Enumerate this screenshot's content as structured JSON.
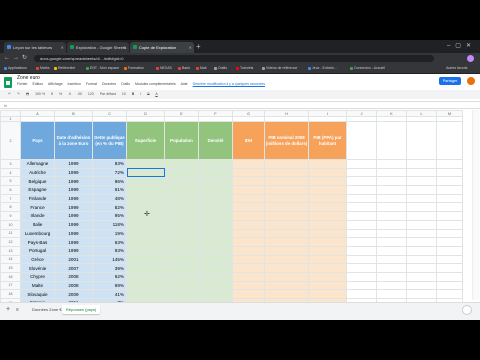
{
  "browser": {
    "tabs": [
      {
        "label": "Leçon sur les tableurs",
        "color": "#4285f4"
      },
      {
        "label": "Exploration - Google Sheets",
        "color": "#0f9d58"
      },
      {
        "label": "Copie de Exploration",
        "color": "#0f9d58"
      }
    ],
    "active_tab": 2,
    "url": "docs.google.com/spreadsheets/d/…/edit#gid=0",
    "bookmarks": [
      "Applications",
      "Maths",
      "Référentiel",
      "ENT - Mon espace",
      "Formation",
      "NEXAS",
      "Bank",
      "Mail",
      "Outils",
      "Tutoriels",
      "Vidéos de référence",
      "Jeux - Entraîn…",
      "Connexion - Accueil"
    ],
    "other_bookmarks": "Autres favoris"
  },
  "sheets": {
    "doc_title": "Zone euro",
    "menu": [
      "Fichier",
      "Édition",
      "Affichage",
      "Insertion",
      "Format",
      "Données",
      "Outils",
      "Modules complémentaires",
      "Aide"
    ],
    "last_edit": "Dernière modification il y a quelques secondes",
    "share_label": "Partager",
    "toolbar": [
      "↶",
      "↷",
      "🖶",
      "100 %",
      "€",
      "%",
      ".0",
      ".00",
      "123",
      "Par défaut",
      "10",
      "B",
      "I",
      "S",
      "A"
    ],
    "fx": "fx",
    "column_letters": [
      "A",
      "B",
      "C",
      "D",
      "E",
      "F",
      "G",
      "H",
      "I",
      "J",
      "K",
      "L",
      "M"
    ],
    "headers": {
      "pays": "Pays",
      "date": "Date d'adhésion à la zone Euro",
      "dette": "Dette publique (en % du PIB)",
      "superficie": "Superficie",
      "population": "Population",
      "densite": "Densité",
      "idh": "IDH",
      "pib": "PIB nominal 2008 (millions de dollars)",
      "pib_hab": "PIB (PPA) par habitant"
    },
    "rows": [
      {
        "pays": "Allemagne",
        "date": "1999",
        "dette": "83%"
      },
      {
        "pays": "Autriche",
        "date": "1999",
        "dette": "72%"
      },
      {
        "pays": "Belgique",
        "date": "1999",
        "dette": "96%"
      },
      {
        "pays": "Espagne",
        "date": "1999",
        "dette": "61%"
      },
      {
        "pays": "Finlande",
        "date": "1999",
        "dette": "48%"
      },
      {
        "pays": "France",
        "date": "1999",
        "dette": "82%"
      },
      {
        "pays": "Irlande",
        "date": "1999",
        "dette": "95%"
      },
      {
        "pays": "Italie",
        "date": "1999",
        "dette": "118%"
      },
      {
        "pays": "Luxembourg",
        "date": "1999",
        "dette": "19%"
      },
      {
        "pays": "Pays-Bas",
        "date": "1999",
        "dette": "63%"
      },
      {
        "pays": "Portugal",
        "date": "1999",
        "dette": "93%"
      },
      {
        "pays": "Grèce",
        "date": "2001",
        "dette": "145%"
      },
      {
        "pays": "Slovénie",
        "date": "2007",
        "dette": "39%"
      },
      {
        "pays": "Chypre",
        "date": "2008",
        "dette": "62%"
      },
      {
        "pays": "Malte",
        "date": "2008",
        "dette": "69%"
      },
      {
        "pays": "Slovaquie",
        "date": "2009",
        "dette": "41%"
      },
      {
        "pays": "Estonie",
        "date": "2011",
        "dette": "7%"
      }
    ],
    "sheet_tabs": [
      "Données Zone €",
      "Réponses (pays)"
    ],
    "colors": {
      "blue": "#6fa8dc",
      "green": "#93c47d",
      "orange": "#f6a25b",
      "accent": "#1a73e8"
    }
  }
}
